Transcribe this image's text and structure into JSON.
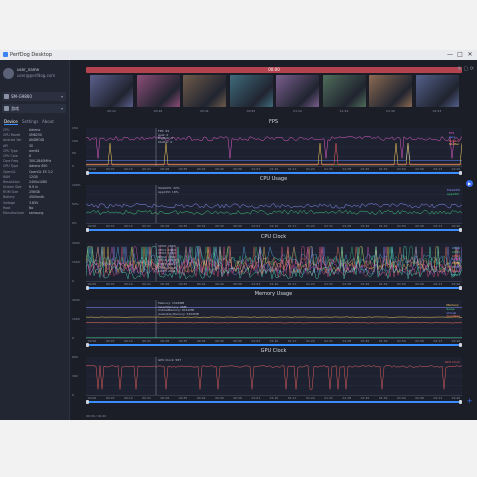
{
  "window": {
    "title": "PerfDog Desktop"
  },
  "user": {
    "name": "user_name",
    "email": "user@perfdog.com"
  },
  "device": {
    "label": "SM-G9860",
    "chevron": "▾"
  },
  "app": {
    "label": "游戏",
    "chevron": "▾"
  },
  "tabs": [
    "Device",
    "Settings",
    "About"
  ],
  "device_props": [
    {
      "k": "CPU",
      "v": "Adreno"
    },
    {
      "k": "GPU Model",
      "v": "SM8250"
    },
    {
      "k": "Android Ver",
      "v": "ANDROID"
    },
    {
      "k": "API",
      "v": "30"
    },
    {
      "k": "CPU Type",
      "v": "arm64"
    },
    {
      "k": "CPU Core",
      "v": "8"
    },
    {
      "k": "Core Freq",
      "v": "300-2840MHz"
    },
    {
      "k": "GPU Type",
      "v": "Adreno 650"
    },
    {
      "k": "OpenGL",
      "v": "OpenGL ES 3.2"
    },
    {
      "k": "RAM",
      "v": "12GB"
    },
    {
      "k": "Resolution",
      "v": "2400x1080"
    },
    {
      "k": "Screen Size",
      "v": "6.9 in"
    },
    {
      "k": "ROM Size",
      "v": "256GB"
    },
    {
      "k": "Battery",
      "v": "4500mAh"
    },
    {
      "k": "Voltage",
      "v": "3.85V"
    },
    {
      "k": "Root",
      "v": "No"
    },
    {
      "k": "Manufacturer",
      "v": "samsung"
    }
  ],
  "topbar": {
    "label": "00:00"
  },
  "thumbnails": [
    {
      "time": "00:12",
      "color": "#5a5f8c"
    },
    {
      "time": "00:26",
      "color": "#8e4d78"
    },
    {
      "time": "00:41",
      "color": "#6f5b4a"
    },
    {
      "time": "00:55",
      "color": "#3f6b7c"
    },
    {
      "time": "01:10",
      "color": "#7a5e8e"
    },
    {
      "time": "01:24",
      "color": "#4f6d5a"
    },
    {
      "time": "01:39",
      "color": "#8c6a52"
    },
    {
      "time": "01:53",
      "color": "#53608a"
    }
  ],
  "time_axis": [
    "00:00",
    "00:07",
    "00:14",
    "00:21",
    "00:28",
    "00:35",
    "00:42",
    "00:49",
    "00:56",
    "01:03",
    "01:10",
    "01:17",
    "01:24",
    "01:31",
    "01:38",
    "01:45",
    "01:52",
    "01:59",
    "02:06",
    "02:13",
    "02:20"
  ],
  "panels": [
    {
      "title": "FPS",
      "ylabels": [
        "150",
        "100",
        "50",
        "0"
      ],
      "annotation": [
        "FPS: 59",
        "Jank: 0",
        "BigJank: 0",
        "Stutter: 0"
      ],
      "legend": [
        {
          "label": "FPS",
          "color": "#e45bc9"
        },
        {
          "label": "Jank",
          "color": "#5b8cff"
        },
        {
          "label": "BigJank",
          "color": "#ff5b5b"
        },
        {
          "label": "Stutter",
          "color": "#ffd15b"
        }
      ]
    },
    {
      "title": "CPU Usage",
      "ylabels": [
        "100%",
        "50%",
        "0%"
      ],
      "annotation": [
        "TotalCPU: 32%",
        "AppCPU: 18%"
      ],
      "legend": [
        {
          "label": "TotalCPU",
          "color": "#8c93ff"
        },
        {
          "label": "AppCPU",
          "color": "#3ec97a"
        }
      ]
    },
    {
      "title": "CPU Clock",
      "ylabels": [
        "3000",
        "1500",
        "0"
      ],
      "annotation": [
        "CPU0: 1804",
        "CPU1: 1804",
        "CPU2: 1804",
        "CPU3: 1804",
        "CPU4: 2419",
        "CPU5: 2419",
        "CPU6: 2419",
        "CPU7: 2841"
      ],
      "legend": [
        {
          "label": "CPU0",
          "color": "#5bc0ff"
        },
        {
          "label": "CPU1",
          "color": "#3ec97a"
        },
        {
          "label": "CPU2",
          "color": "#ff7a5b"
        },
        {
          "label": "CPU3",
          "color": "#e45bc9"
        },
        {
          "label": "CPU4",
          "color": "#ffd15b"
        },
        {
          "label": "CPU5",
          "color": "#8c93ff"
        },
        {
          "label": "CPU6",
          "color": "#ff5b8c"
        },
        {
          "label": "CPU7",
          "color": "#5bffd1"
        }
      ]
    },
    {
      "title": "Memory Usage",
      "ylabels": [
        "3000",
        "1500",
        "0"
      ],
      "annotation": [
        "Memory: 1528MB",
        "SwapMemory: 0MB",
        "VirtualMemory: 9012MB",
        "Available Memory: 5320MB"
      ],
      "legend": [
        {
          "label": "Memory",
          "color": "#ffd15b"
        },
        {
          "label": "Swap",
          "color": "#3ec97a"
        },
        {
          "label": "Virtual",
          "color": "#8c93ff"
        },
        {
          "label": "Available",
          "color": "#ff7a5b"
        }
      ]
    },
    {
      "title": "GPU Clock",
      "ylabels": [
        "600",
        "300",
        "0"
      ],
      "annotation": [
        "GPU Clock: 587"
      ],
      "legend": [
        {
          "label": "GPU Clock",
          "color": "#e05b5b"
        }
      ]
    }
  ],
  "status": {
    "text": "00:00 / 02:20"
  },
  "icons": {
    "play": "▶",
    "add": "+",
    "minimize": "—",
    "maximize": "□",
    "close": "✕"
  },
  "topicons": "⚙ ▢ ⟳"
}
